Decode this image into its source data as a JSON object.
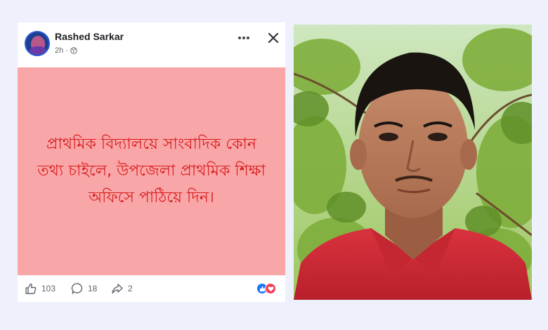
{
  "post": {
    "author": "Rashed Sarkar",
    "time": "2h",
    "separator": "·",
    "privacy_icon": "globe-icon",
    "menu_icon": "more-horizontal-icon",
    "close_icon": "close-icon",
    "body_text": "প্রাথমিক বিদ্যালয়ে সাংবাদিক কোন তথ্য চাইলে, উপজেলা প্রাথমিক শিক্ষা অফিসে পাঠিয়ে দিন।",
    "background_color": "#f9a6a8",
    "text_color": "#d81b1b"
  },
  "footer": {
    "likes": "103",
    "comments": "18",
    "shares": "2",
    "reaction_icons": [
      "like-reaction-icon",
      "love-reaction-icon"
    ]
  },
  "photo": {
    "subject": "man-in-red-shirt-portrait"
  }
}
